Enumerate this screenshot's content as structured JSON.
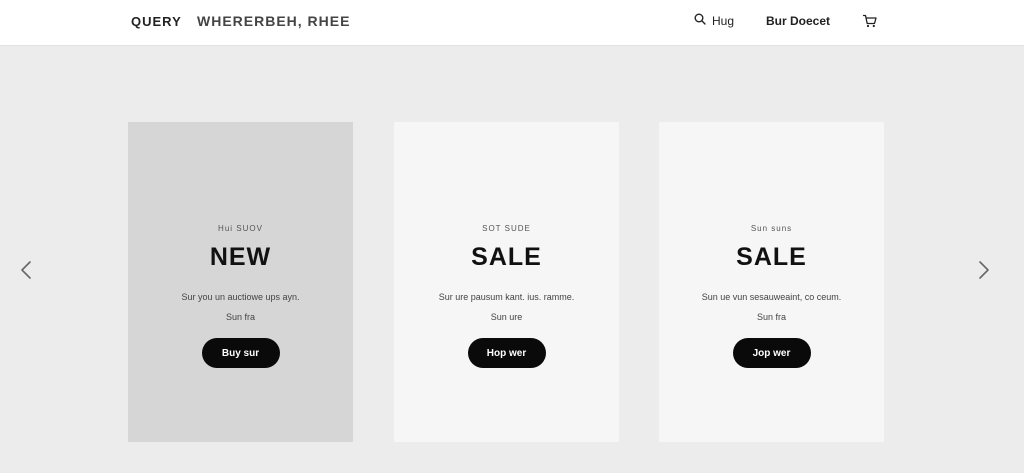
{
  "header": {
    "brand": "QUERY",
    "tagline": "WHERERBEH, RHEE",
    "search_label": "Hug",
    "account_label": "Bur Doecet"
  },
  "carousel": {
    "slides": [
      {
        "eyebrow": "Hui SUOV",
        "headline": "NEW",
        "body": "Sur you un auctiowe ups ayn.",
        "sub": "Sun fra",
        "cta": "Buy sur"
      },
      {
        "eyebrow": "SOT SUDE",
        "headline": "SALE",
        "body": "Sur ure pausum kant. ius. ramme.",
        "sub": "Sun ure",
        "cta": "Hop wer"
      },
      {
        "eyebrow": "Sun suns",
        "headline": "SALE",
        "body": "Sun ue vun sesauweaint, co ceum.",
        "sub": "Sun fra",
        "cta": "Jop wer"
      }
    ]
  },
  "icons": {
    "search": "search-icon",
    "cart": "cart-icon",
    "prev": "chevron-left-icon",
    "next": "chevron-right-icon"
  },
  "colors": {
    "page_bg": "#ececec",
    "header_bg": "#ffffff",
    "card_highlight": "#d6d6d6",
    "card": "#f6f6f6",
    "button": "#0a0a0a"
  }
}
